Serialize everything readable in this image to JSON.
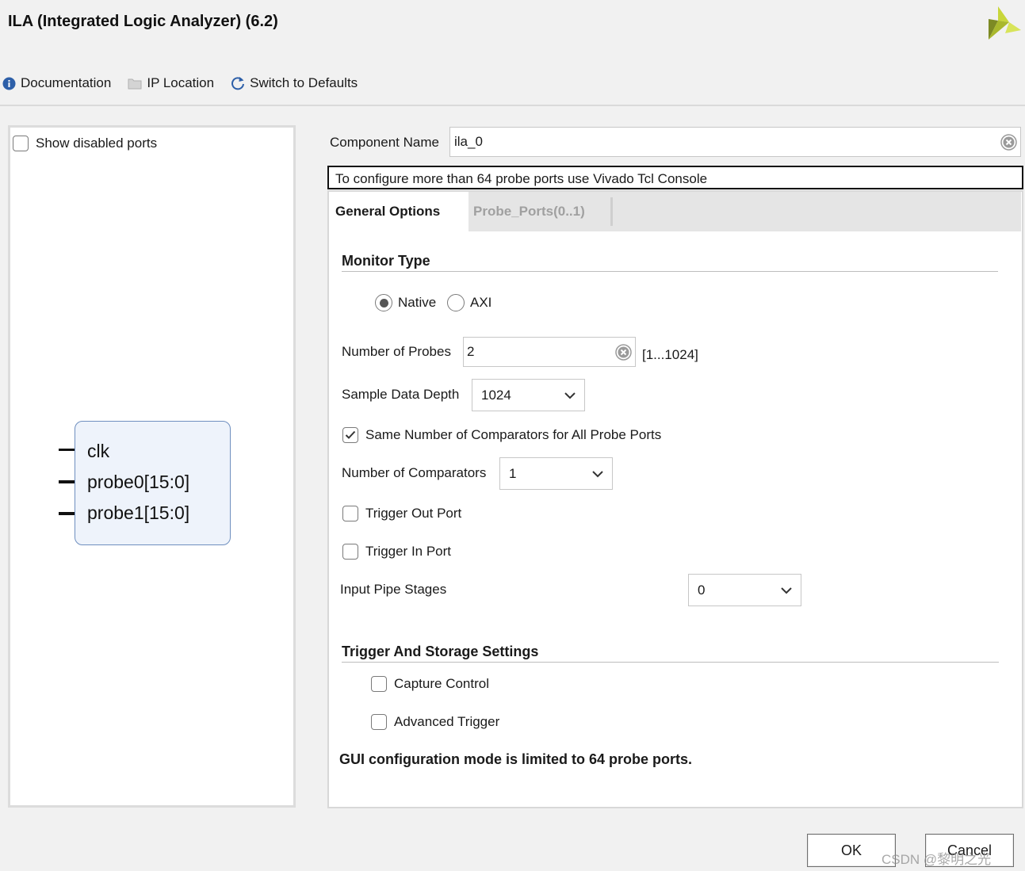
{
  "window": {
    "title": "ILA (Integrated Logic Analyzer) (6.2)",
    "logo_icon": "xilinx-logo-icon"
  },
  "toolbar": {
    "documentation": "Documentation",
    "ip_location": "IP Location",
    "switch_defaults": "Switch to Defaults"
  },
  "left_panel": {
    "show_disabled_ports": "Show disabled ports",
    "show_disabled_checked": false,
    "ports": [
      "clk",
      "probe0[15:0]",
      "probe1[15:0]"
    ]
  },
  "component": {
    "label": "Component Name",
    "value": "ila_0"
  },
  "info_banner": "To configure more than 64 probe ports use Vivado Tcl Console",
  "tabs": [
    {
      "label": "General Options",
      "active": true
    },
    {
      "label": "Probe_Ports(0..1)",
      "active": false
    }
  ],
  "general": {
    "monitor_type_title": "Monitor Type",
    "monitor_native": "Native",
    "monitor_axi": "AXI",
    "monitor_selected": "Native",
    "num_probes_label": "Number of Probes",
    "num_probes_value": "2",
    "num_probes_range": "[1...1024]",
    "sample_depth_label": "Sample Data Depth",
    "sample_depth_value": "1024",
    "same_comparators_label": "Same Number of Comparators for All Probe Ports",
    "same_comparators_checked": true,
    "num_comparators_label": "Number of Comparators",
    "num_comparators_value": "1",
    "trigger_out_label": "Trigger Out Port",
    "trigger_out_checked": false,
    "trigger_in_label": "Trigger In Port",
    "trigger_in_checked": false,
    "pipe_stages_label": "Input Pipe Stages",
    "pipe_stages_value": "0",
    "trigger_storage_title": "Trigger And Storage Settings",
    "capture_control_label": "Capture Control",
    "capture_control_checked": false,
    "advanced_trigger_label": "Advanced Trigger",
    "advanced_trigger_checked": false,
    "gui_note": "GUI configuration mode is limited to 64 probe ports."
  },
  "buttons": {
    "ok": "OK",
    "cancel": "Cancel"
  },
  "watermark": "CSDN @黎明之光",
  "colors": {
    "accent_blue": "#2d5fa8",
    "logo_green": "#b5c733",
    "logo_dark": "#6e7c1e"
  }
}
